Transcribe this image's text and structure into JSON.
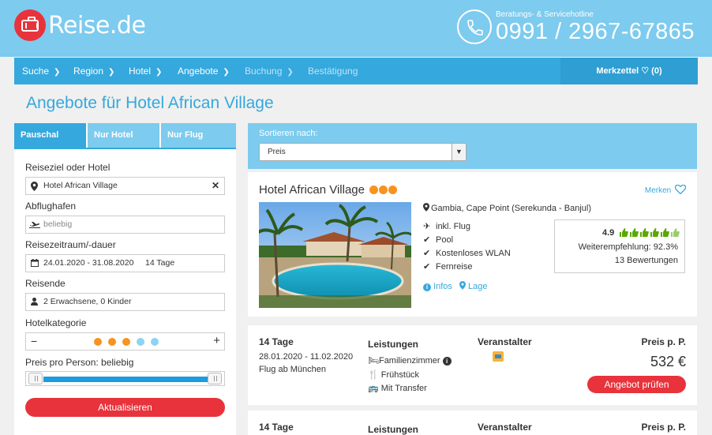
{
  "header": {
    "logo_text": "Reise",
    "logo_tld": ".de",
    "hotline_label": "Beratungs- & Servicehotline",
    "hotline_number": "0991 / 2967-67865"
  },
  "nav": {
    "items": [
      {
        "label": "Suche"
      },
      {
        "label": "Region"
      },
      {
        "label": "Hotel"
      },
      {
        "label": "Angebote"
      },
      {
        "label": "Buchung"
      },
      {
        "label": "Bestätigung"
      }
    ],
    "merkzettel": "Merkzettel ♡ (0)"
  },
  "page_title": "Angebote für Hotel African Village",
  "sidebar": {
    "tabs": [
      "Pauschal",
      "Nur Hotel",
      "Nur Flug"
    ],
    "destination_label": "Reiseziel oder Hotel",
    "destination_value": "Hotel African Village",
    "airport_label": "Abflughafen",
    "airport_placeholder": "beliebig",
    "period_label": "Reisezeitraum/-dauer",
    "period_value": "24.01.2020 - 31.08.2020     14 Tage",
    "travelers_label": "Reisende",
    "travelers_value": "2 Erwachsene, 0 Kinder",
    "category_label": "Hotelkategorie",
    "category_minus": "−",
    "category_plus": "+",
    "category_selected": 3,
    "category_max": 5,
    "category_colors": {
      "active": "#f7931e",
      "inactive": "#8fd3f2"
    },
    "price_label": "Preis pro Person: beliebig",
    "update_button": "Aktualisieren"
  },
  "sort": {
    "label": "Sortieren nach:",
    "selected": "Preis"
  },
  "hotel": {
    "name": "Hotel African Village",
    "stars": 3,
    "merken": "Merken",
    "location": "Gambia, Cape Point (Serekunda - Banjul)",
    "features": [
      "inkl. Flug",
      "Pool",
      "Kostenloses WLAN",
      "Fernreise"
    ],
    "link_infos": "Infos",
    "link_lage": "Lage",
    "rating_score": "4.9",
    "rating_thumbs": 6,
    "recommendation": "Weiterempfehlung: 92.3%",
    "reviews": "13 Bewertungen"
  },
  "offers": [
    {
      "duration": "14 Tage",
      "dates": "28.01.2020 - 11.02.2020",
      "departure": "Flug ab München",
      "services_label": "Leistungen",
      "services": [
        "Familienzimmer",
        "Frühstück",
        "Mit Transfer"
      ],
      "operator_label": "Veranstalter",
      "price_label": "Preis p. P.",
      "price": "532 €",
      "button": "Angebot prüfen"
    },
    {
      "duration": "14 Tage",
      "services_label": "Leistungen",
      "operator_label": "Veranstalter",
      "price_label": "Preis p. P."
    }
  ],
  "colors": {
    "header": "#7dcbee",
    "nav": "#35a8dd",
    "accent_red": "#e8333c",
    "star_orange": "#f7931e"
  }
}
